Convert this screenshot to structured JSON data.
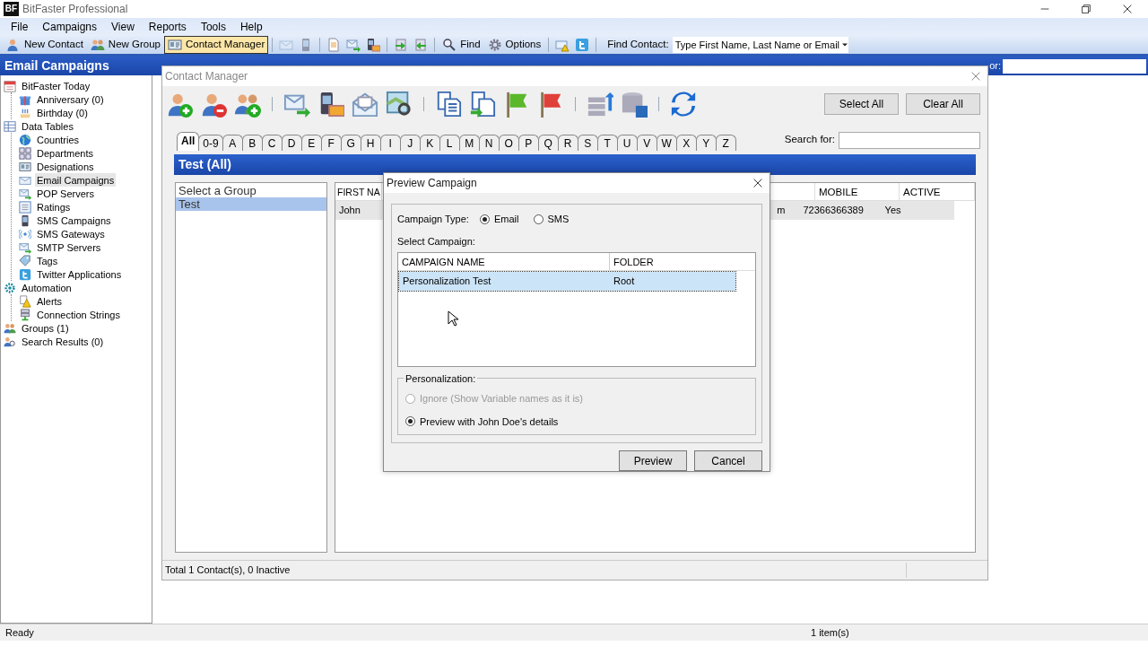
{
  "window": {
    "logo": "BF",
    "title": "BitFaster Professional"
  },
  "menu": [
    "File",
    "Campaigns",
    "View",
    "Reports",
    "Tools",
    "Help"
  ],
  "toolbar": [
    {
      "kind": "button",
      "label": "New Contact",
      "selected": false
    },
    {
      "kind": "button",
      "label": "New Group",
      "selected": false
    },
    {
      "kind": "button",
      "label": "Contact Manager",
      "selected": true
    },
    {
      "kind": "separator"
    },
    {
      "kind": "icon",
      "disabled": true
    },
    {
      "kind": "icon",
      "disabled": true
    },
    {
      "kind": "separator"
    },
    {
      "kind": "icon",
      "disabled": false
    },
    {
      "kind": "icon",
      "disabled": false
    },
    {
      "kind": "icon",
      "disabled": false
    },
    {
      "kind": "separator"
    },
    {
      "kind": "icon",
      "disabled": false
    },
    {
      "kind": "icon",
      "disabled": false
    },
    {
      "kind": "separator"
    },
    {
      "kind": "button",
      "label": "Find",
      "selected": false
    },
    {
      "kind": "button",
      "label": "Options",
      "selected": false
    },
    {
      "kind": "separator"
    },
    {
      "kind": "icon",
      "disabled": false
    },
    {
      "kind": "icon",
      "disabled": false
    },
    {
      "kind": "separator"
    }
  ],
  "find_contact": {
    "label": "Find Contact:",
    "value": "Type First Name, Last Name or Email"
  },
  "section_title": "Email Campaigns",
  "top_search": {
    "label": "or:"
  },
  "tree": [
    {
      "label": "BitFaster Today",
      "selected": false,
      "children": [
        {
          "label": "Anniversary (0)",
          "selected": false
        },
        {
          "label": "Birthday (0)",
          "selected": false
        }
      ]
    },
    {
      "label": "Data Tables",
      "selected": false,
      "children": [
        {
          "label": "Countries",
          "selected": false
        },
        {
          "label": "Departments",
          "selected": false
        },
        {
          "label": "Designations",
          "selected": false
        },
        {
          "label": "Email Campaigns",
          "selected": true
        },
        {
          "label": "POP Servers",
          "selected": false
        },
        {
          "label": "Ratings",
          "selected": false
        },
        {
          "label": "SMS Campaigns",
          "selected": false
        },
        {
          "label": "SMS Gateways",
          "selected": false
        },
        {
          "label": "SMTP Servers",
          "selected": false
        },
        {
          "label": "Tags",
          "selected": false
        },
        {
          "label": "Twitter Applications",
          "selected": false
        }
      ]
    },
    {
      "label": "Automation",
      "selected": false,
      "children": [
        {
          "label": "Alerts",
          "selected": false
        },
        {
          "label": "Connection Strings",
          "selected": false
        }
      ]
    },
    {
      "label": "Groups (1)",
      "selected": false
    },
    {
      "label": "Search Results (0)",
      "selected": false
    }
  ],
  "contact_manager": {
    "title": "Contact Manager",
    "buttons": [
      "Select All",
      "Clear All"
    ],
    "tabs": [
      {
        "label": "All",
        "selected": true
      },
      {
        "label": "0-9",
        "selected": false
      },
      {
        "label": "A",
        "selected": false
      },
      {
        "label": "B",
        "selected": false
      },
      {
        "label": "C",
        "selected": false
      },
      {
        "label": "D",
        "selected": false
      },
      {
        "label": "E",
        "selected": false
      },
      {
        "label": "F",
        "selected": false
      },
      {
        "label": "G",
        "selected": false
      },
      {
        "label": "H",
        "selected": false
      },
      {
        "label": "I",
        "selected": false
      },
      {
        "label": "J",
        "selected": false
      },
      {
        "label": "K",
        "selected": false
      },
      {
        "label": "L",
        "selected": false
      },
      {
        "label": "M",
        "selected": false
      },
      {
        "label": "N",
        "selected": false
      },
      {
        "label": "O",
        "selected": false
      },
      {
        "label": "P",
        "selected": false
      },
      {
        "label": "Q",
        "selected": false
      },
      {
        "label": "R",
        "selected": false
      },
      {
        "label": "S",
        "selected": false
      },
      {
        "label": "T",
        "selected": false
      },
      {
        "label": "U",
        "selected": false
      },
      {
        "label": "V",
        "selected": false
      },
      {
        "label": "W",
        "selected": false
      },
      {
        "label": "X",
        "selected": false
      },
      {
        "label": "Y",
        "selected": false
      },
      {
        "label": "Z",
        "selected": false
      }
    ],
    "search_label": "Search for:",
    "header": "Test (All)",
    "groups": [
      {
        "label": "Select a Group",
        "selected": false
      },
      {
        "label": "Test",
        "selected": true
      }
    ],
    "columns": [
      {
        "label": "FIRST NA"
      },
      {},
      {
        "label": "MOBILE"
      },
      {
        "label": "ACTIVE"
      }
    ],
    "rows": [
      {
        "cells": [
          "John",
          "m",
          "72366366389",
          "Yes"
        ],
        "selected": true
      }
    ],
    "status": "Total 1 Contact(s), 0 Inactive"
  },
  "dialog": {
    "title": "Preview Campaign",
    "type_label": "Campaign Type:",
    "types": [
      {
        "label": "Email",
        "selected": true
      },
      {
        "label": "SMS",
        "selected": false
      }
    ],
    "select_label": "Select Campaign:",
    "columns": [
      "CAMPAIGN NAME",
      "FOLDER"
    ],
    "rows": [
      {
        "cells": [
          "Personalization Test",
          "Root"
        ],
        "selected": true
      }
    ],
    "personalization_label": "Personalization:",
    "options": [
      {
        "label": "Ignore (Show Variable names as it is)",
        "selected": false,
        "disabled": true
      },
      {
        "label": "Preview with John Doe's details",
        "selected": true,
        "disabled": false
      }
    ],
    "buttons": [
      "Preview",
      "Cancel"
    ]
  },
  "status_bar": {
    "left": "Ready",
    "right": "1 item(s)"
  }
}
